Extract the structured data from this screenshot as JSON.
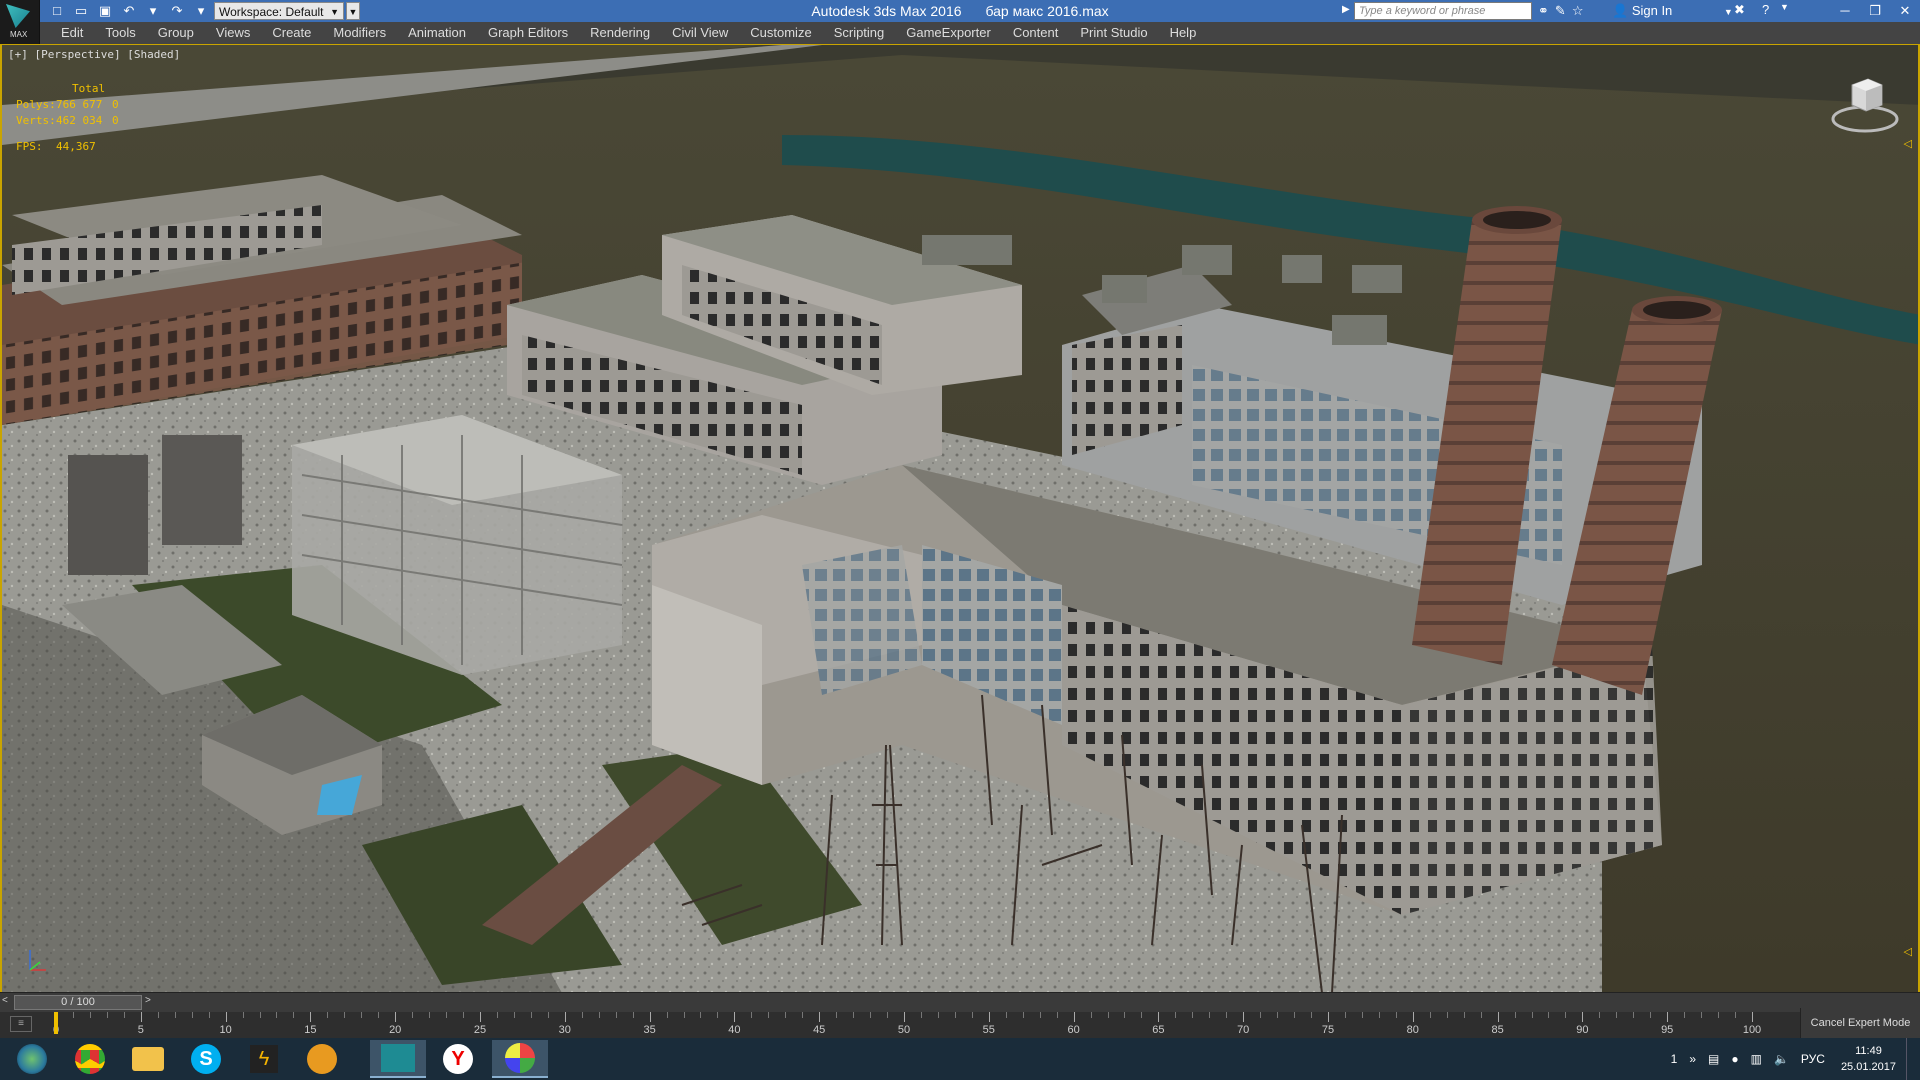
{
  "app": {
    "logo_text": "MAX",
    "title": "Autodesk 3ds Max 2016",
    "file": "бар макс 2016.max",
    "workspace_label": "Workspace: Default",
    "search_placeholder": "Type a keyword or phrase",
    "sign_in": "Sign In"
  },
  "menu": [
    "Edit",
    "Tools",
    "Group",
    "Views",
    "Create",
    "Modifiers",
    "Animation",
    "Graph Editors",
    "Rendering",
    "Civil View",
    "Customize",
    "Scripting",
    "GameExporter",
    "Content",
    "Print Studio",
    "Help"
  ],
  "viewport": {
    "label": "[+] [Perspective] [Shaded]",
    "stats": {
      "header": "Total",
      "polys_label": "Polys:",
      "polys_total": "766 677",
      "polys_sel": "0",
      "verts_label": "Verts:",
      "verts_total": "462 034",
      "verts_sel": "0",
      "fps_label": "FPS:",
      "fps": "44,367"
    }
  },
  "timeline": {
    "frame": "0 / 100",
    "prev": "<",
    "next": ">",
    "tick_labels": [
      "0",
      "5",
      "10",
      "15",
      "20",
      "25",
      "30",
      "35",
      "40",
      "45",
      "50",
      "55",
      "60",
      "65",
      "70",
      "75",
      "80",
      "85",
      "90",
      "95",
      "100"
    ],
    "expert_mode": "Cancel Expert Mode"
  },
  "taskbar": {
    "apps": [
      "start-orb",
      "chrome",
      "file-explorer",
      "skype",
      "winamp",
      "paint-palette",
      "3ds-max",
      "yandex-browser",
      "paint"
    ],
    "tray_count": "1",
    "language": "РУС",
    "time": "11:49",
    "date": "25.01.2017"
  }
}
